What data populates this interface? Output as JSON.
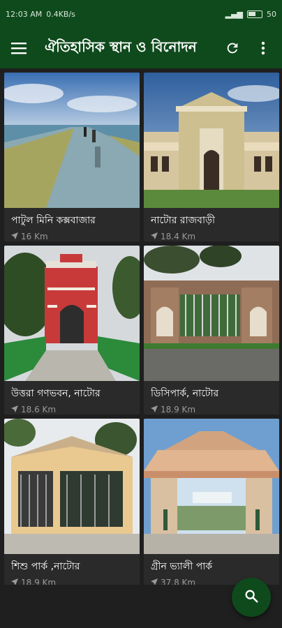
{
  "status": {
    "time": "12:03 AM",
    "speed": "0.4KB/s",
    "battery": "50"
  },
  "appbar": {
    "title": "ঐতিহাসিক স্থান ও বিনোদন"
  },
  "cards": [
    {
      "name": "পাটুল মিনি কক্সবাজার",
      "distance": "16 Km"
    },
    {
      "name": "নাটোর রাজবাড়ী",
      "distance": "18.4 Km"
    },
    {
      "name": "উত্তরা গণভবন, নাটোর",
      "distance": "18.6 Km"
    },
    {
      "name": "ডিসিপার্ক, নাটোর",
      "distance": "18.9 Km"
    },
    {
      "name": "শিশু পার্ক ,নাটোর",
      "distance": "18.9 Km"
    },
    {
      "name": "গ্রীন ভ্যালী পার্ক",
      "distance": "37.8 Km"
    }
  ],
  "icons": {
    "menu": "menu-icon",
    "refresh": "refresh-icon",
    "more": "more-vert-icon",
    "search": "search-icon",
    "location": "navigation-icon"
  },
  "colors": {
    "primary": "#0f4a1c",
    "background": "#1f1f1f",
    "card": "#2a2a2a"
  }
}
